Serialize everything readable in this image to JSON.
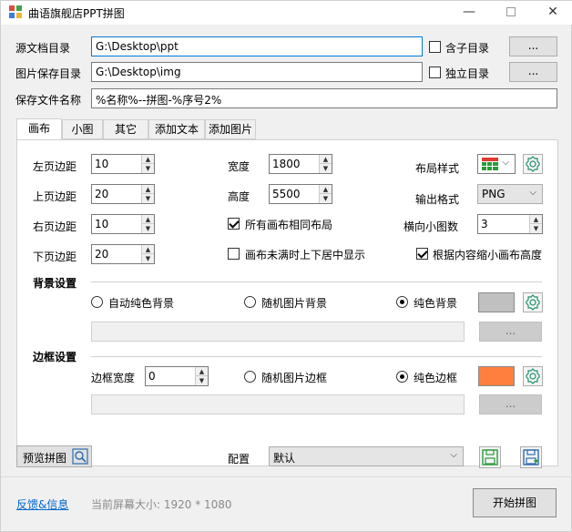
{
  "window": {
    "title": "曲语旗舰店PPT拼图"
  },
  "paths": {
    "source_label": "源文档目录",
    "source_value": "G:\\Desktop\\ppt",
    "include_sub_label": "含子目录",
    "image_label": "图片保存目录",
    "image_value": "G:\\Desktop\\img",
    "independent_label": "独立目录",
    "filename_label": "保存文件名称",
    "filename_value": "%名称%--拼图-%序号2%",
    "browse_label": "..."
  },
  "tabs": [
    "画布",
    "小图",
    "其它",
    "添加文本",
    "添加图片"
  ],
  "canvas": {
    "left_margin_label": "左页边距",
    "left_margin": "10",
    "top_margin_label": "上页边距",
    "top_margin": "20",
    "right_margin_label": "右页边距",
    "right_margin": "10",
    "bottom_margin_label": "下页边距",
    "bottom_margin": "20",
    "width_label": "宽度",
    "width": "1800",
    "height_label": "高度",
    "height": "5500",
    "same_layout_label": "所有画布相同布局",
    "center_label": "画布未满时上下居中显示",
    "layout_style_label": "布局样式",
    "output_format_label": "输出格式",
    "output_format": "PNG",
    "h_count_label": "横向小图数",
    "h_count": "3",
    "shrink_label": "根据内容缩小画布高度"
  },
  "background": {
    "section": "背景设置",
    "auto_label": "自动纯色背景",
    "random_label": "随机图片背景",
    "solid_label": "纯色背景",
    "color": "#c0c0c0",
    "browse_label": "..."
  },
  "border": {
    "section": "边框设置",
    "width_label": "边框宽度",
    "width": "0",
    "random_label": "随机图片边框",
    "solid_label": "纯色边框",
    "color": "#ff7f3f",
    "browse_label": "..."
  },
  "bottom": {
    "preview_label": "预览拼图",
    "config_label": "配置",
    "config_value": "默认",
    "feedback_label": "反馈&信息",
    "screen_info": "当前屏幕大小: 1920 * 1080",
    "start_label": "开始拼图"
  }
}
